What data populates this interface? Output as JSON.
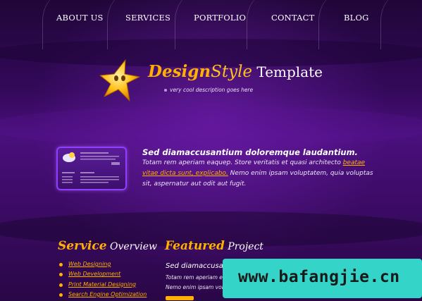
{
  "nav": {
    "items": [
      {
        "label": "ABOUT US"
      },
      {
        "label": "SERVICES"
      },
      {
        "label": "PORTFOLIO"
      },
      {
        "label": "CONTACT"
      },
      {
        "label": "BLOG"
      }
    ]
  },
  "logo": {
    "design": "Design",
    "style": "Style",
    "template": " Template",
    "tagline": "very cool description goes here"
  },
  "feature": {
    "heading": "Sed diamaccusantium doloremque laudantium.",
    "text_before": "Totam rem aperiam eaquep. Store veritatis et quasi architecto ",
    "link": "beatae vitae dicta sunt, explicabo.",
    "text_after": " Nemo enim ipsam voluptatem, quia voluptas sit, aspernatur aut odit aut fugit."
  },
  "service": {
    "title_bold": "Service",
    "title_light": " Overview",
    "items": [
      {
        "label": "Web Designing"
      },
      {
        "label": "Web Development"
      },
      {
        "label": "Print Material Designing"
      },
      {
        "label": "Search Engine Optimization"
      }
    ]
  },
  "featured": {
    "title_bold": "Featured",
    "title_light": " Project",
    "heading": "Sed diamaccusantium",
    "line1": "Totam rem aperiam eaquep",
    "line2": "Nemo enim ipsam volupta"
  },
  "watermark": {
    "text": "www.bafangjie.cn"
  },
  "colors": {
    "accent": "#ffb000",
    "background": "#2a0747",
    "thumb_border": "#8f3dff",
    "watermark_bg": "#35d4c8"
  }
}
